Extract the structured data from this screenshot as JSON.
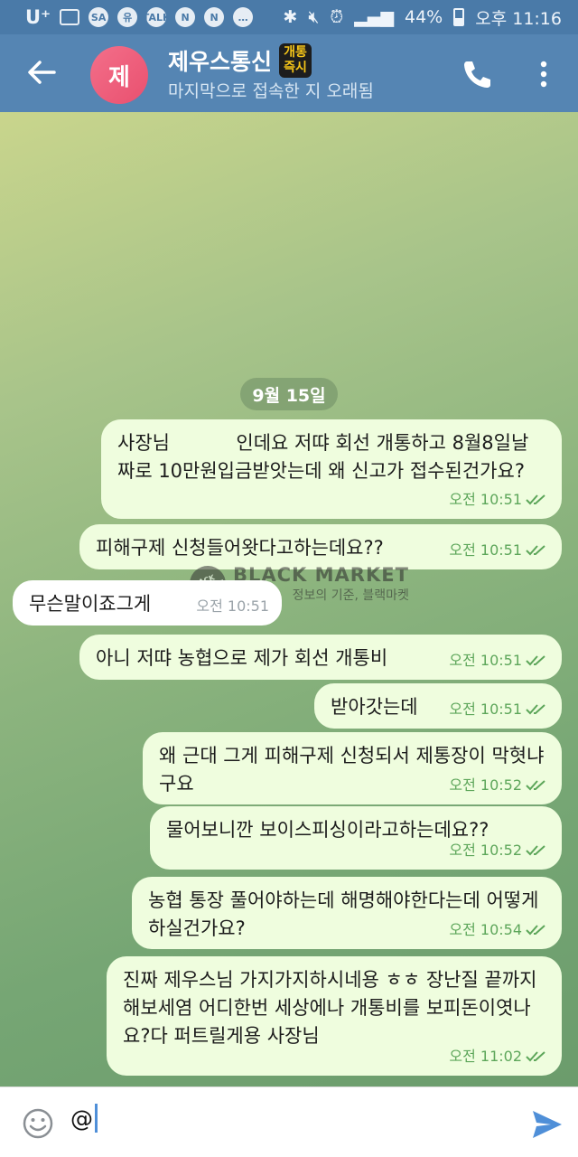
{
  "status_bar": {
    "carrier": "U⁺",
    "battery": "44%",
    "time_label": "오후 11:16",
    "mini_icons": [
      "SA",
      "유",
      "TALK",
      "N",
      "N"
    ]
  },
  "header": {
    "avatar_initial": "제",
    "title": "제우스통신",
    "badge_line1": "개통",
    "badge_line2": "즉시",
    "subtitle": "마지막으로 접속한 지 오래됨"
  },
  "date_separator": "9월 15일",
  "messages": [
    {
      "dir": "out",
      "text": "사장님           인데요 저땨 회선 개통하고 8월8일날짜로 10만원입금받앗는데 왜 신고가 접수된건가요?",
      "time": "오전 10:51"
    },
    {
      "dir": "out",
      "text": "피해구제 신청들어왓다고하는데요??",
      "time": "오전 10:51"
    },
    {
      "dir": "in",
      "text": "무슨말이죠그게",
      "time": "오전 10:51"
    },
    {
      "dir": "out",
      "text": "아니 저땨 농협으로 제가 회선 개통비",
      "time": "오전 10:51"
    },
    {
      "dir": "out",
      "text": "받아갓는데",
      "time": "오전 10:51"
    },
    {
      "dir": "out",
      "text": "왜 근대 그게 피해구제 신청되서 제통장이 막혓냐구요",
      "time": "오전 10:52"
    },
    {
      "dir": "out",
      "text": "물어보니깐 보이스피싱이라고하는데요??",
      "time": "오전 10:52"
    },
    {
      "dir": "out",
      "text": "농협 통장 풀어야하는데 해명해야한다는데 어떻게하실건가요?",
      "time": "오전 10:54"
    },
    {
      "dir": "out",
      "text": "진짜 제우스님 가지가지하시네용 ㅎㅎ 장난질 끝까지해보세염 어디한번 세상에나 개통비를 보피돈이엿나요?다 퍼트릴게용 사장님",
      "time": "오전 11:02"
    }
  ],
  "watermark": {
    "title": "BLACK MARKET",
    "subtitle": "정보의 기준, 블랙마켓",
    "logo_text": "BLACK MARKET"
  },
  "composer": {
    "value": "@"
  },
  "colors": {
    "header": "#5585b3",
    "statusbar": "#4a7aa8",
    "outgoing": "#effdde",
    "check": "#5da65a",
    "send": "#4f8fd8"
  }
}
